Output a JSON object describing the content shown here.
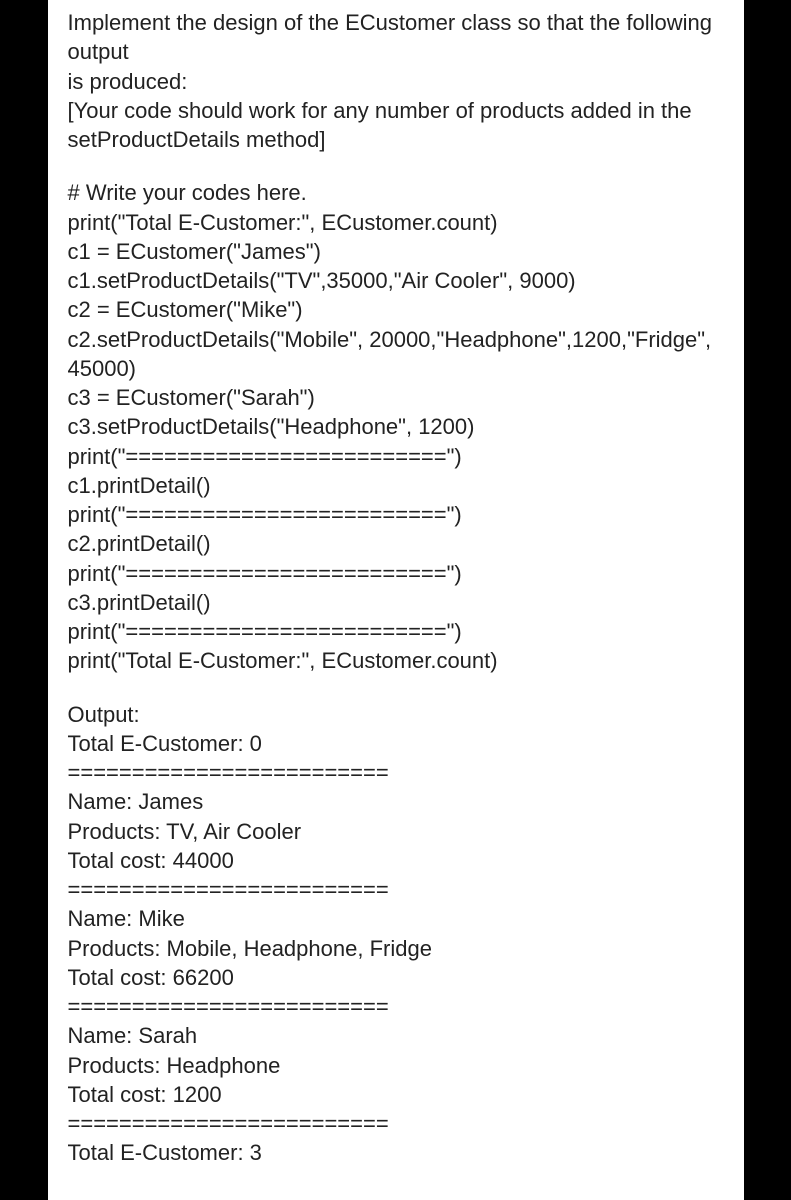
{
  "intro": [
    "Implement the design of the ECustomer class so that the following output",
    "is produced:",
    "[Your code should work for any number of products added in the",
    "setProductDetails method]"
  ],
  "code": [
    "# Write your codes here.",
    "print(\"Total E-Customer:\", ECustomer.count)",
    "c1 = ECustomer(\"James\")",
    "c1.setProductDetails(\"TV\",35000,\"Air Cooler\", 9000)",
    "c2 = ECustomer(\"Mike\")",
    "c2.setProductDetails(\"Mobile\", 20000,\"Headphone\",1200,\"Fridge\", 45000)",
    "c3 = ECustomer(\"Sarah\")",
    "c3.setProductDetails(\"Headphone\", 1200)",
    "print(\"=========================\")",
    "c1.printDetail()",
    "print(\"=========================\")",
    "c2.printDetail()",
    "print(\"=========================\")",
    "c3.printDetail()",
    "print(\"=========================\")",
    "print(\"Total E-Customer:\", ECustomer.count)"
  ],
  "output": [
    "Output:",
    "Total E-Customer: 0",
    "=========================",
    "Name: James",
    "Products: TV, Air Cooler",
    "Total cost: 44000",
    "=========================",
    "Name: Mike",
    "Products: Mobile, Headphone, Fridge",
    "Total cost: 66200",
    "=========================",
    "Name: Sarah",
    "Products: Headphone",
    "Total cost: 1200",
    "=========================",
    "Total E-Customer: 3"
  ]
}
